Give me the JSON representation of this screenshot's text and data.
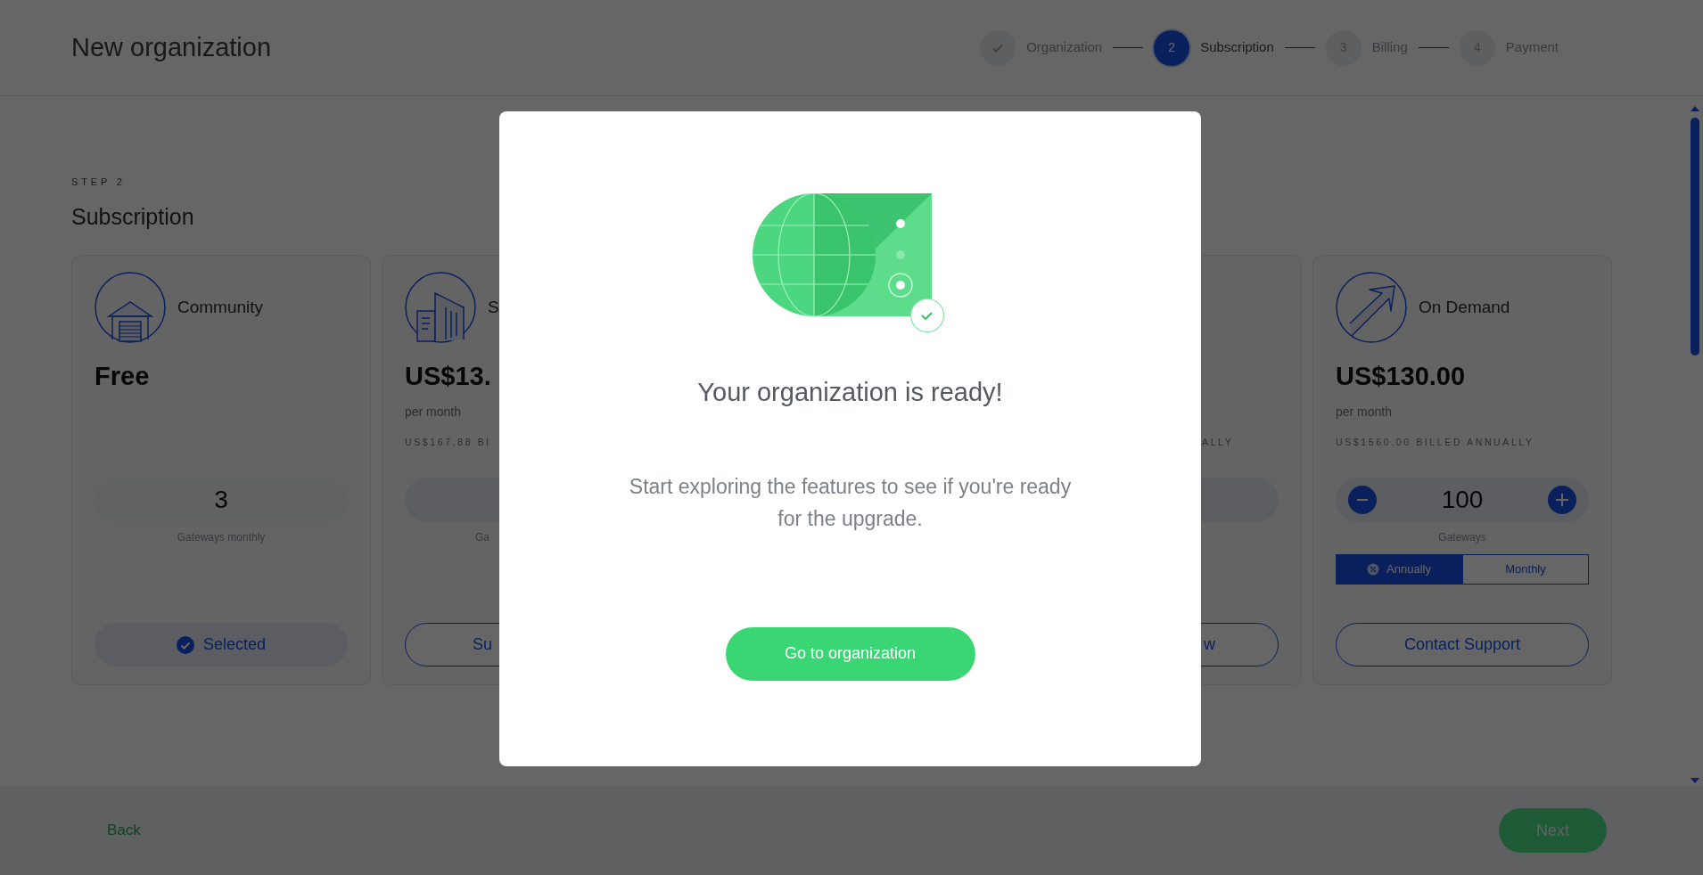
{
  "header": {
    "title": "New organization",
    "steps": [
      {
        "label": "Organization",
        "completed": true,
        "selected": false
      },
      {
        "number": "2",
        "label": "Subscription",
        "completed": false,
        "selected": true
      },
      {
        "number": "3",
        "label": "Billing",
        "completed": false,
        "selected": false
      },
      {
        "number": "4",
        "label": "Payment",
        "completed": false,
        "selected": false
      }
    ]
  },
  "section": {
    "eyebrow": "STEP 2",
    "title": "Subscription"
  },
  "plans": [
    {
      "kind": "community",
      "name": "Community",
      "price": "Free",
      "quantity": "3",
      "quantity_label": "Gateways monthly",
      "action": "Selected",
      "selected": true
    },
    {
      "kind": "cut_right",
      "name": "S",
      "price": "US$13.",
      "period": "per month",
      "billed": "US$167.88 BI",
      "quantity_label": "Ga",
      "action": "Su",
      "selected": false
    },
    {
      "kind": "cut_left",
      "billed": "ALLY",
      "action": "w",
      "selected": false
    },
    {
      "kind": "on_demand",
      "name": "On Demand",
      "price": "US$130.00",
      "period": "per month",
      "billed": "US$1560.00 BILLED ANNUALLY",
      "quantity": "100",
      "quantity_label": "Gateways",
      "billing_options": [
        {
          "label": "Annually",
          "selected": true
        },
        {
          "label": "Monthly",
          "selected": false
        }
      ],
      "action": "Contact Support",
      "selected": false
    }
  ],
  "footer": {
    "back": "Back",
    "next": "Next"
  },
  "modal": {
    "title": "Your organization is ready!",
    "message": "Start exploring the features to see if you're ready for the upgrade.",
    "button": "Go to organization"
  }
}
